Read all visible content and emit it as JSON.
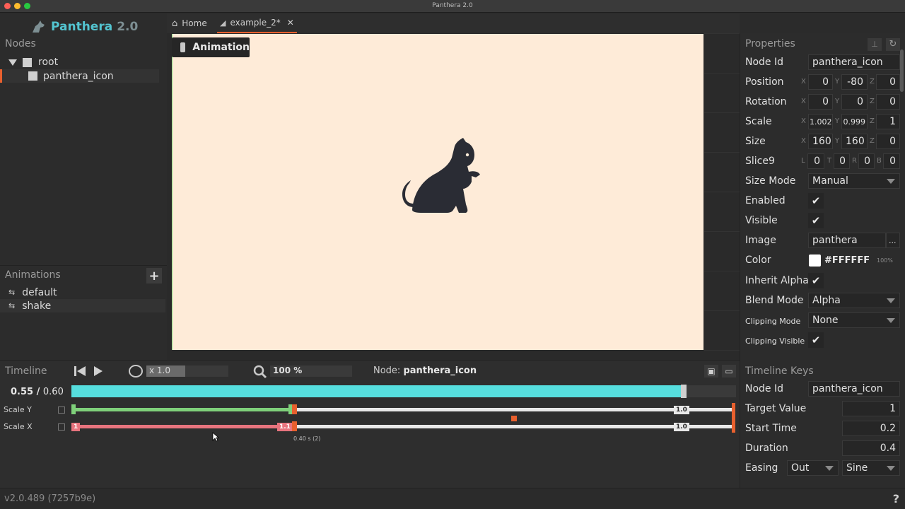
{
  "window": {
    "title": "Panthera 2.0"
  },
  "app": {
    "brand": "Panthera",
    "version": "2.0"
  },
  "nodes": {
    "title": "Nodes",
    "items": [
      {
        "label": "root"
      },
      {
        "label": "panthera_icon",
        "selected": true
      }
    ]
  },
  "animations": {
    "title": "Animations",
    "items": [
      {
        "label": "default"
      },
      {
        "label": "shake",
        "selected": true
      }
    ]
  },
  "tabs": [
    {
      "label": "Home",
      "icon": "home-icon"
    },
    {
      "label": "example_2*",
      "icon": "cat-icon",
      "active": true
    }
  ],
  "viewport": {
    "badge": "Animation",
    "background": "#feebd8"
  },
  "properties": {
    "title": "Properties",
    "node_id_label": "Node Id",
    "node_id": "panthera_icon",
    "position_label": "Position",
    "position": [
      "0",
      "-80",
      "0"
    ],
    "rotation_label": "Rotation",
    "rotation": [
      "0",
      "0",
      "0"
    ],
    "scale_label": "Scale",
    "scale": [
      "1.002",
      "0.999",
      "1"
    ],
    "size_label": "Size",
    "size": [
      "160",
      "160",
      "0"
    ],
    "slice9_label": "Slice9",
    "slice9": [
      "0",
      "0",
      "0",
      "0"
    ],
    "size_mode_label": "Size Mode",
    "size_mode": "Manual",
    "enabled_label": "Enabled",
    "visible_label": "Visible",
    "image_label": "Image",
    "image": "panthera",
    "image_more": "...",
    "color_label": "Color",
    "color": "#FFFFFF",
    "color_alpha": "100%",
    "inherit_alpha_label": "Inherit Alpha",
    "blend_mode_label": "Blend Mode",
    "blend_mode": "Alpha",
    "clipping_mode_label": "Clipping Mode",
    "clipping_mode": "None",
    "clipping_visible_label": "Clipping Visible",
    "axes": {
      "x": "X",
      "y": "Y",
      "z": "Z",
      "l": "L",
      "t": "T",
      "r": "R",
      "b": "B"
    }
  },
  "timeline": {
    "title": "Timeline",
    "speed": "x 1.0",
    "zoom": "100 %",
    "node_prefix": "Node:",
    "node_name": "panthera_icon",
    "current_time": "0.55",
    "separator": "/",
    "total_time": "0.60",
    "progress": 0.917,
    "tracks": [
      {
        "label": "Scale Y",
        "start_key": "",
        "mid_key": "",
        "end_key": "1.0",
        "color": "#7fd07a"
      },
      {
        "label": "Scale X",
        "start_key": "1",
        "mid_key": "1.1",
        "end_key": "1.0",
        "color": "#e8747e"
      }
    ],
    "key_note": "0.40 s (2)"
  },
  "timeline_keys": {
    "title": "Timeline Keys",
    "node_id_label": "Node Id",
    "node_id": "panthera_icon",
    "target_value_label": "Target Value",
    "target_value": "1",
    "start_time_label": "Start Time",
    "start_time": "0.2",
    "duration_label": "Duration",
    "duration": "0.4",
    "easing_label": "Easing",
    "easing_mode": "Out",
    "easing_type": "Sine"
  },
  "status": {
    "version": "v2.0.489 (7257b9e)",
    "help": "?"
  },
  "colors": {
    "accent": "#e8602e",
    "brand": "#53c4d0",
    "scrub": "#56dede"
  }
}
